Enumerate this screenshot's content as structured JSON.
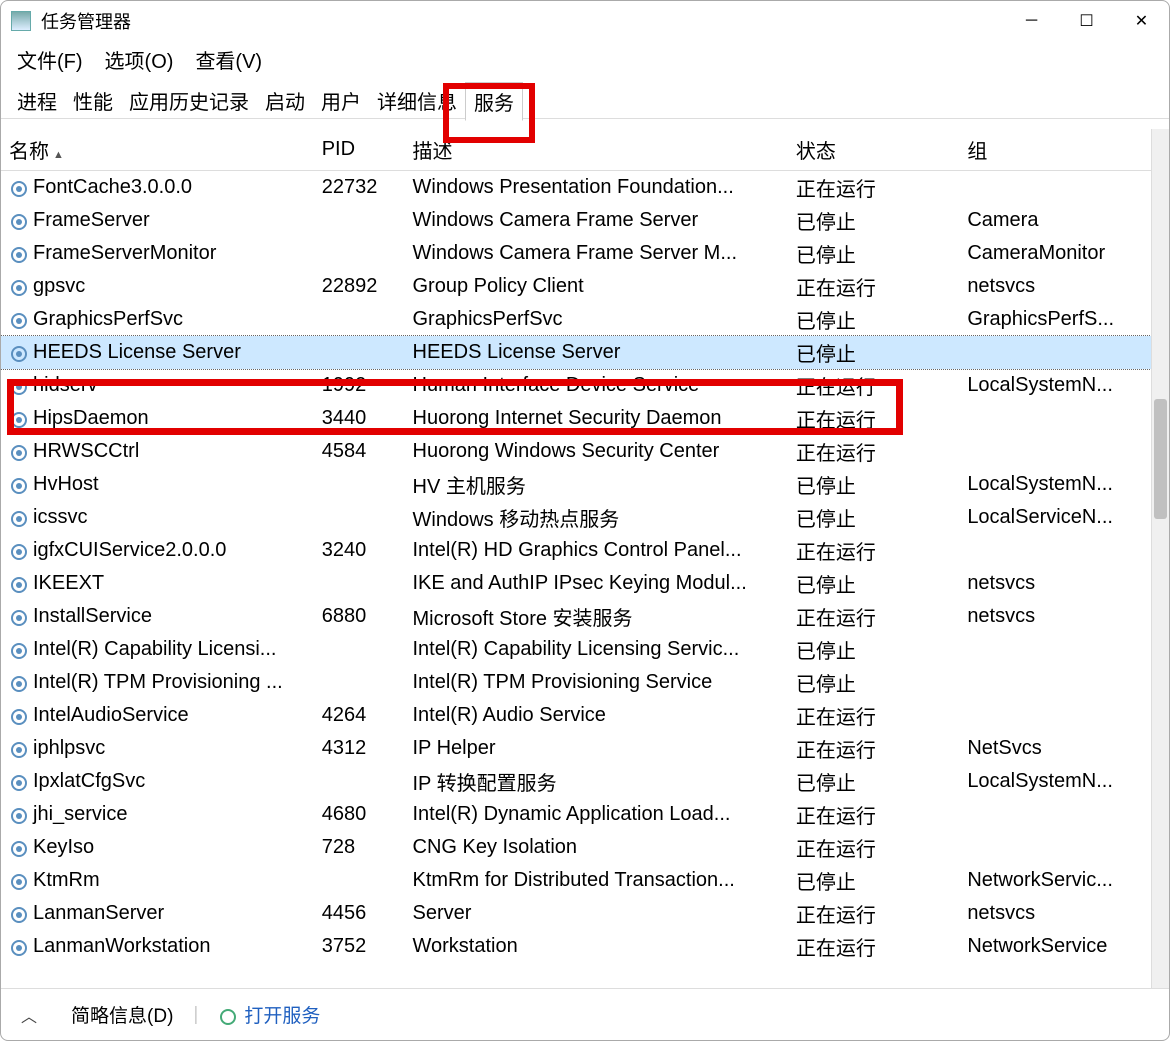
{
  "title": "任务管理器",
  "menus": {
    "file": "文件(F)",
    "options": "选项(O)",
    "view": "查看(V)"
  },
  "tabs": {
    "processes": "进程",
    "performance": "性能",
    "apphistory": "应用历史记录",
    "startup": "启动",
    "users": "用户",
    "details": "详细信息",
    "services": "服务"
  },
  "columns": {
    "name": "名称",
    "pid": "PID",
    "desc": "描述",
    "status": "状态",
    "group": "组"
  },
  "status_running": "正在运行",
  "status_stopped": "已停止",
  "services": [
    {
      "name": "FontCache3.0.0.0",
      "pid": "22732",
      "desc": "Windows Presentation Foundation...",
      "status": "正在运行",
      "group": ""
    },
    {
      "name": "FrameServer",
      "pid": "",
      "desc": "Windows Camera Frame Server",
      "status": "已停止",
      "group": "Camera"
    },
    {
      "name": "FrameServerMonitor",
      "pid": "",
      "desc": "Windows Camera Frame Server M...",
      "status": "已停止",
      "group": "CameraMonitor"
    },
    {
      "name": "gpsvc",
      "pid": "22892",
      "desc": "Group Policy Client",
      "status": "正在运行",
      "group": "netsvcs"
    },
    {
      "name": "GraphicsPerfSvc",
      "pid": "",
      "desc": "GraphicsPerfSvc",
      "status": "已停止",
      "group": "GraphicsPerfS..."
    },
    {
      "name": "HEEDS License Server",
      "pid": "",
      "desc": "HEEDS License Server",
      "status": "已停止",
      "group": "",
      "selected": true
    },
    {
      "name": "hidserv",
      "pid": "1992",
      "desc": "Human Interface Device Service",
      "status": "正在运行",
      "group": "LocalSystemN..."
    },
    {
      "name": "HipsDaemon",
      "pid": "3440",
      "desc": "Huorong Internet Security Daemon",
      "status": "正在运行",
      "group": ""
    },
    {
      "name": "HRWSCCtrl",
      "pid": "4584",
      "desc": "Huorong Windows Security Center",
      "status": "正在运行",
      "group": ""
    },
    {
      "name": "HvHost",
      "pid": "",
      "desc": "HV 主机服务",
      "status": "已停止",
      "group": "LocalSystemN..."
    },
    {
      "name": "icssvc",
      "pid": "",
      "desc": "Windows 移动热点服务",
      "status": "已停止",
      "group": "LocalServiceN..."
    },
    {
      "name": "igfxCUIService2.0.0.0",
      "pid": "3240",
      "desc": "Intel(R) HD Graphics Control Panel...",
      "status": "正在运行",
      "group": ""
    },
    {
      "name": "IKEEXT",
      "pid": "",
      "desc": "IKE and AuthIP IPsec Keying Modul...",
      "status": "已停止",
      "group": "netsvcs"
    },
    {
      "name": "InstallService",
      "pid": "6880",
      "desc": "Microsoft Store 安装服务",
      "status": "正在运行",
      "group": "netsvcs"
    },
    {
      "name": "Intel(R) Capability Licensi...",
      "pid": "",
      "desc": "Intel(R) Capability Licensing Servic...",
      "status": "已停止",
      "group": ""
    },
    {
      "name": "Intel(R) TPM Provisioning ...",
      "pid": "",
      "desc": "Intel(R) TPM Provisioning Service",
      "status": "已停止",
      "group": ""
    },
    {
      "name": "IntelAudioService",
      "pid": "4264",
      "desc": "Intel(R) Audio Service",
      "status": "正在运行",
      "group": ""
    },
    {
      "name": "iphlpsvc",
      "pid": "4312",
      "desc": "IP Helper",
      "status": "正在运行",
      "group": "NetSvcs"
    },
    {
      "name": "IpxlatCfgSvc",
      "pid": "",
      "desc": "IP 转换配置服务",
      "status": "已停止",
      "group": "LocalSystemN..."
    },
    {
      "name": "jhi_service",
      "pid": "4680",
      "desc": "Intel(R) Dynamic Application Load...",
      "status": "正在运行",
      "group": ""
    },
    {
      "name": "KeyIso",
      "pid": "728",
      "desc": "CNG Key Isolation",
      "status": "正在运行",
      "group": ""
    },
    {
      "name": "KtmRm",
      "pid": "",
      "desc": "KtmRm for Distributed Transaction...",
      "status": "已停止",
      "group": "NetworkServic..."
    },
    {
      "name": "LanmanServer",
      "pid": "4456",
      "desc": "Server",
      "status": "正在运行",
      "group": "netsvcs"
    },
    {
      "name": "LanmanWorkstation",
      "pid": "3752",
      "desc": "Workstation",
      "status": "正在运行",
      "group": "NetworkService"
    }
  ],
  "footer": {
    "fewer": "简略信息(D)",
    "open": "打开服务"
  }
}
